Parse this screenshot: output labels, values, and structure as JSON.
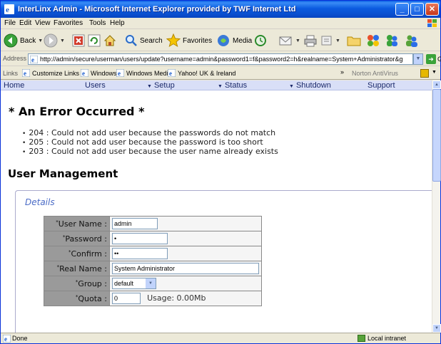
{
  "window": {
    "title": "InterLinx Admin - Microsoft Internet Explorer provided by TWF Internet Ltd"
  },
  "menu": [
    "File",
    "Edit",
    "View",
    "Favorites",
    "Tools",
    "Help"
  ],
  "toolbar": {
    "back": "Back",
    "search": "Search",
    "favorites": "Favorites",
    "media": "Media"
  },
  "address": {
    "label": "Address",
    "url": "http://admin/secure/userman/users/update?username=admin&password1=f&password2=h&realname=System+Administrator&g",
    "go": "Go"
  },
  "links": {
    "label": "Links",
    "items": [
      "Customize Links",
      "Windows",
      "Windows Media",
      "Yahoo! UK & Ireland"
    ],
    "norton": "Norton AntiVirus"
  },
  "nav": [
    "Home",
    "Users",
    "Setup",
    "Status",
    "Shutdown",
    "Support"
  ],
  "error": {
    "heading": "* An Error Occurred *",
    "messages": [
      "204 : Could not add user because the passwords do not match",
      "205 : Could not add user because the password is too short",
      "203 : Could not add user because the user name already exists"
    ]
  },
  "user_management": {
    "heading": "User Management",
    "legend": "Details",
    "fields": {
      "username": {
        "label": "User Name :",
        "value": "admin"
      },
      "password": {
        "label": "Password :",
        "value": "•"
      },
      "confirm": {
        "label": "Confirm :",
        "value": "••"
      },
      "realname": {
        "label": "Real Name :",
        "value": "System Administrator"
      },
      "group": {
        "label": "Group :",
        "value": "default"
      },
      "quota": {
        "label": "Quota :",
        "value": "0",
        "usage": "Usage: 0.00Mb"
      }
    }
  },
  "status": {
    "text": "Done",
    "zone": "Local intranet"
  }
}
